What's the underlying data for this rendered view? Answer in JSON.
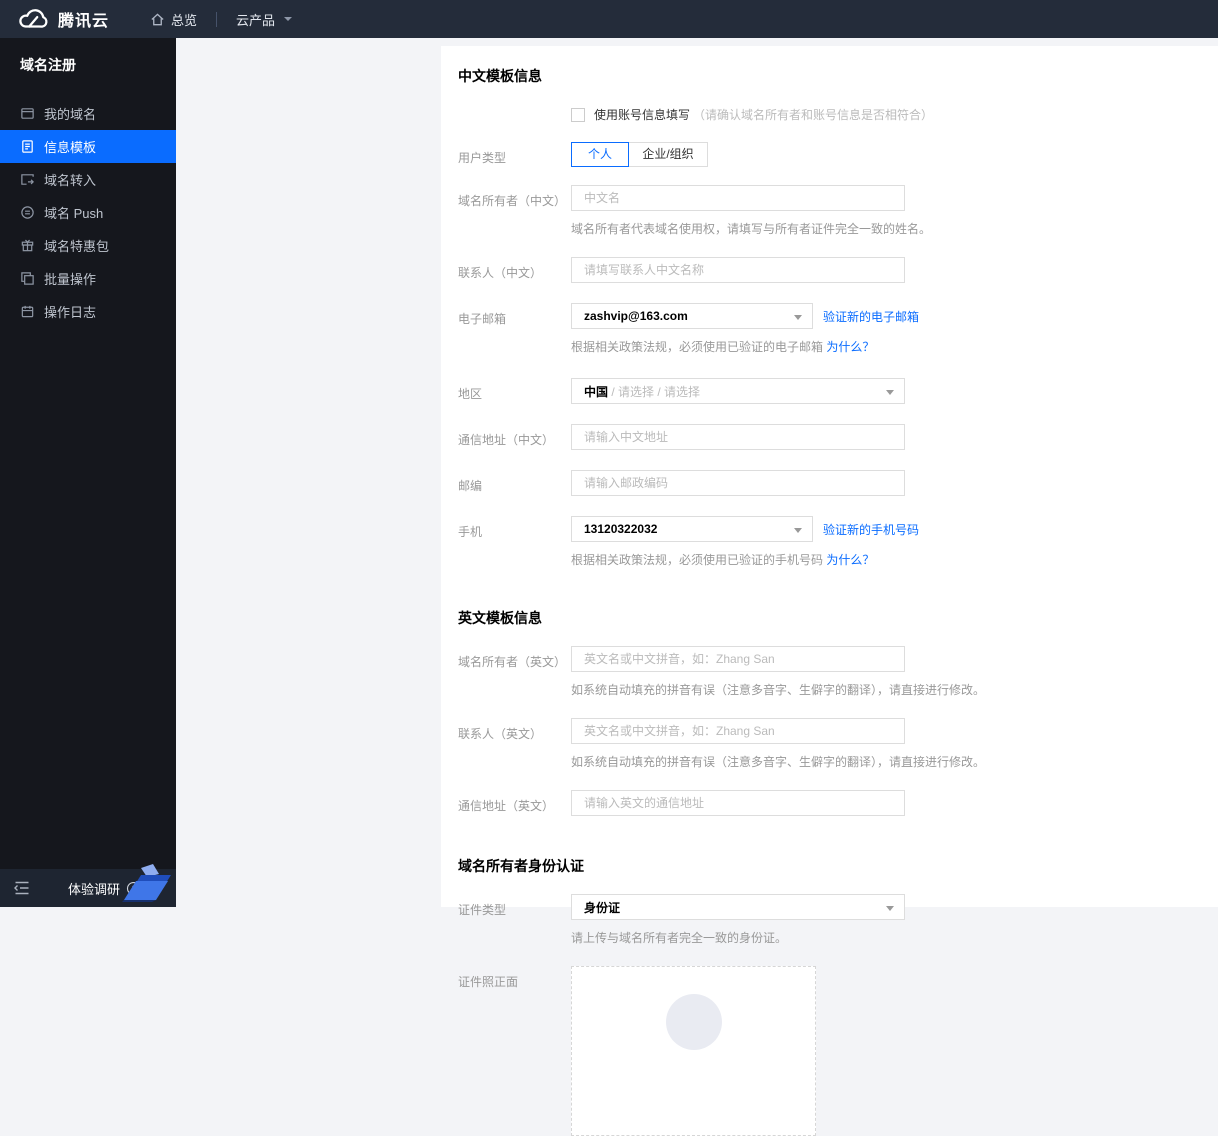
{
  "navbar": {
    "brand": "腾讯云",
    "overview": "总览",
    "products": "云产品"
  },
  "sidebar": {
    "title": "域名注册",
    "items": [
      {
        "label": "我的域名"
      },
      {
        "label": "信息模板"
      },
      {
        "label": "域名转入"
      },
      {
        "label": "域名 Push"
      },
      {
        "label": "域名特惠包"
      },
      {
        "label": "批量操作"
      },
      {
        "label": "操作日志"
      }
    ],
    "footer": {
      "survey": "体验调研"
    }
  },
  "form": {
    "cn": {
      "title": "中文模板信息",
      "use_account": {
        "label": "使用账号信息填写",
        "note": "（请确认域名所有者和账号信息是否相符合）",
        "checked": false
      },
      "user_type": {
        "label": "用户类型",
        "personal": "个人",
        "org": "企业/组织",
        "selected": "个人"
      },
      "owner": {
        "label": "域名所有者（中文）",
        "placeholder": "中文名",
        "value": "",
        "help": "域名所有者代表域名使用权，请填写与所有者证件完全一致的姓名。"
      },
      "contact": {
        "label": "联系人（中文）",
        "placeholder": "请填写联系人中文名称",
        "value": ""
      },
      "email": {
        "label": "电子邮箱",
        "value": "zashvip@163.com",
        "action": "验证新的电子邮箱",
        "help": "根据相关政策法规，必须使用已验证的电子邮箱 ",
        "help_link": "为什么？"
      },
      "region": {
        "label": "地区",
        "value": "中国",
        "rest": " / 请选择 / 请选择"
      },
      "address": {
        "label": "通信地址（中文）",
        "placeholder": "请输入中文地址",
        "value": ""
      },
      "zipcode": {
        "label": "邮编",
        "placeholder": "请输入邮政编码",
        "value": ""
      },
      "phone": {
        "label": "手机",
        "value": "13120322032",
        "action": "验证新的手机号码",
        "help": "根据相关政策法规，必须使用已验证的手机号码 ",
        "help_link": "为什么？"
      }
    },
    "en": {
      "title": "英文模板信息",
      "owner": {
        "label": "域名所有者（英文）",
        "placeholder": "英文名或中文拼音，如：Zhang San",
        "value": "",
        "help": "如系统自动填充的拼音有误（注意多音字、生僻字的翻译），请直接进行修改。"
      },
      "contact": {
        "label": "联系人（英文）",
        "placeholder": "英文名或中文拼音，如：Zhang San",
        "value": "",
        "help": "如系统自动填充的拼音有误（注意多音字、生僻字的翻译），请直接进行修改。"
      },
      "address": {
        "label": "通信地址（英文）",
        "placeholder": "请输入英文的通信地址",
        "value": ""
      }
    },
    "identity": {
      "title": "域名所有者身份认证",
      "cert_type": {
        "label": "证件类型",
        "value": "身份证",
        "help": "请上传与域名所有者完全一致的身份证。"
      },
      "cert_front": {
        "label": "证件照正面"
      }
    }
  },
  "colors": {
    "accent": "#0a6cff",
    "navbar_bg": "#242c3a",
    "sidebar_bg": "#15171d",
    "page_bg": "#f3f4f7"
  },
  "icons": {
    "brand": "cloud",
    "overview": "home",
    "products": "chevron-down",
    "select_caret": "chevron-down",
    "survey_arrow": "chevron-right-circle"
  }
}
